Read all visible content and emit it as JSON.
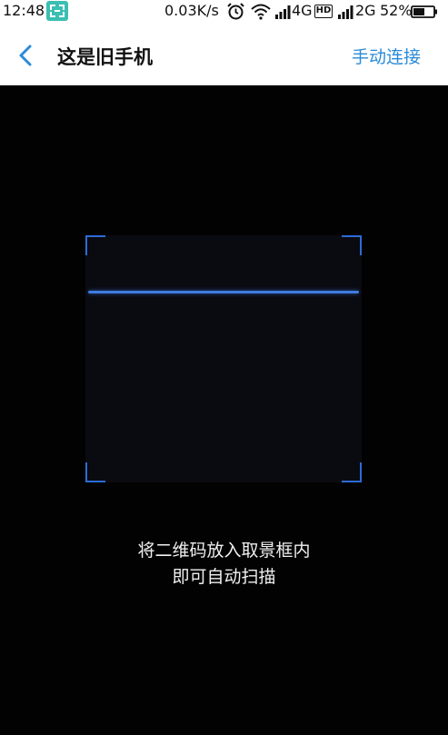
{
  "status_bar": {
    "time": "12:48",
    "net_speed": "0.03K/s",
    "network1": "4G",
    "hd_label": "HD",
    "network2": "2G",
    "battery": "52%",
    "icons": [
      "scan-app-icon",
      "alarm-icon",
      "wifi-icon",
      "signal-icon",
      "battery-icon"
    ]
  },
  "header": {
    "title": "这是旧手机",
    "action": "手动连接",
    "accent_color": "#2a8bd9"
  },
  "scanner": {
    "frame_color": "#2e6bd6",
    "hint_line1": "将二维码放入取景框内",
    "hint_line2": "即可自动扫描"
  }
}
